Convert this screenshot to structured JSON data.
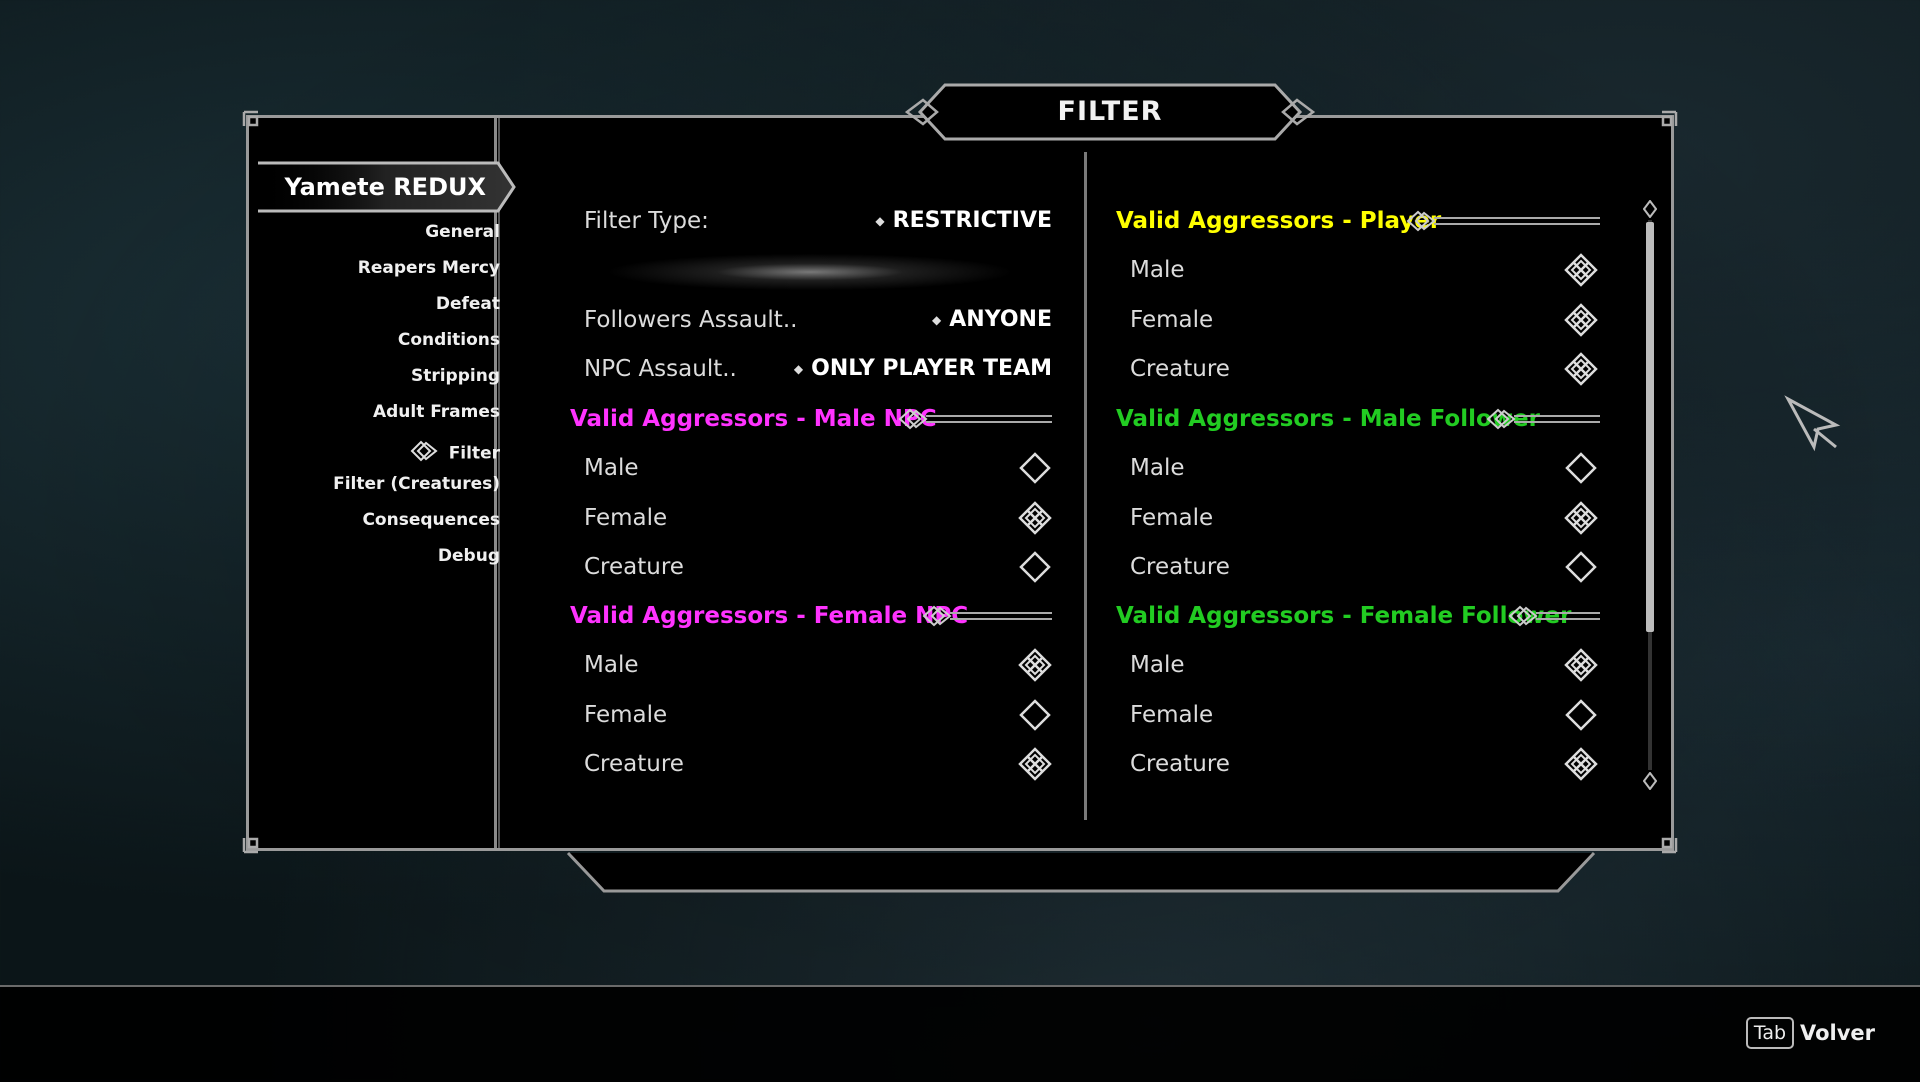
{
  "title": "FILTER",
  "mod_name": "Yamete REDUX",
  "sidebar": {
    "items": [
      {
        "label": "General"
      },
      {
        "label": "Reapers Mercy"
      },
      {
        "label": "Defeat"
      },
      {
        "label": "Conditions"
      },
      {
        "label": "Stripping"
      },
      {
        "label": "Adult Frames"
      },
      {
        "label": "Filter",
        "selected": true
      },
      {
        "label": "Filter (Creatures)"
      },
      {
        "label": "Consequences"
      },
      {
        "label": "Debug"
      }
    ]
  },
  "left": {
    "filter_type": {
      "label": "Filter Type:",
      "value": "RESTRICTIVE"
    },
    "followers_assault": {
      "label": "Followers Assault..",
      "value": "ANYONE"
    },
    "npc_assault": {
      "label": "NPC Assault..",
      "value": "ONLY PLAYER TEAM"
    },
    "male_npc": {
      "header": "Valid Aggressors - Male NPC",
      "color": "#ff33ff",
      "rows": [
        {
          "label": "Male",
          "checked": false
        },
        {
          "label": "Female",
          "checked": true
        },
        {
          "label": "Creature",
          "checked": false
        }
      ]
    },
    "female_npc": {
      "header": "Valid Aggressors - Female NPC",
      "color": "#ff33ff",
      "rows": [
        {
          "label": "Male",
          "checked": true
        },
        {
          "label": "Female",
          "checked": false
        },
        {
          "label": "Creature",
          "checked": true
        }
      ]
    }
  },
  "right": {
    "player": {
      "header": "Valid Aggressors - Player",
      "color": "#ffff00",
      "rows": [
        {
          "label": "Male",
          "checked": true
        },
        {
          "label": "Female",
          "checked": true
        },
        {
          "label": "Creature",
          "checked": true
        }
      ]
    },
    "male_follower": {
      "header": "Valid Aggressors - Male Follower",
      "color": "#22cc22",
      "rows": [
        {
          "label": "Male",
          "checked": false
        },
        {
          "label": "Female",
          "checked": true
        },
        {
          "label": "Creature",
          "checked": false
        }
      ]
    },
    "female_follower": {
      "header": "Valid Aggressors - Female Follower",
      "color": "#22cc22",
      "rows": [
        {
          "label": "Male",
          "checked": true
        },
        {
          "label": "Female",
          "checked": false
        },
        {
          "label": "Creature",
          "checked": true
        }
      ]
    }
  },
  "footer": {
    "key": "Tab",
    "label": "Volver"
  },
  "icons": {
    "checked": "checked-knot-icon",
    "unchecked": "unchecked-diamond-icon"
  }
}
